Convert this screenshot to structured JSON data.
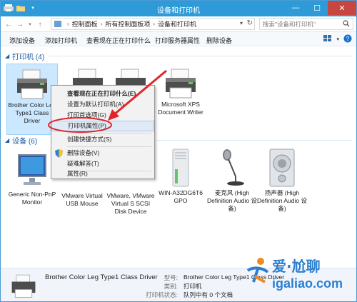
{
  "window": {
    "title": "设备和打印机",
    "controls": [
      "—",
      "☐",
      "✕"
    ]
  },
  "address": {
    "crumbs": [
      "控制面板",
      "所有控制面板项",
      "设备和打印机"
    ],
    "search_placeholder": "搜索\"设备和打印机\""
  },
  "toolbar": {
    "items": [
      "添加设备",
      "添加打印机",
      "查看现在正在打印什么",
      "打印服务器属性",
      "删除设备"
    ]
  },
  "printers": {
    "header": "打印机 (4)",
    "items": [
      {
        "label": "Brother Color Leg Type1 Class Driver",
        "icon": "printer-icon"
      },
      {
        "label": "",
        "icon": "printer-icon"
      },
      {
        "label": "",
        "icon": "printer-icon"
      },
      {
        "label": "Microsoft XPS Document Writer",
        "icon": "printer-icon"
      }
    ]
  },
  "devices": {
    "header": "设备 (6)",
    "items": [
      {
        "label": "Generic Non-PnP Monitor",
        "icon": "monitor-icon"
      },
      {
        "label": "VMware Virtual USB Mouse",
        "icon": "mouse-icon"
      },
      {
        "label": "VMware, VMware Virtual S SCSI Disk Device",
        "icon": "disk-icon"
      },
      {
        "label": "WIN-A32DG6T6 GPO",
        "icon": "computer-tower-icon"
      },
      {
        "label": "麦克风 (High Definition Audio 设备)",
        "icon": "microphone-icon"
      },
      {
        "label": "扬声器 (High Definition Audio 设备)",
        "icon": "speaker-icon"
      }
    ]
  },
  "context_menu": {
    "items": [
      {
        "label": "查看现在正在打印什么(E)",
        "bold": true
      },
      {
        "label": "设置为默认打印机(A)"
      },
      {
        "label": "打印首选项(G)"
      },
      {
        "label": "打印机属性(P)",
        "highlighted": true
      },
      {
        "label": "创建快捷方式(S)"
      },
      {
        "label": "删除设备(V)",
        "shield": true
      },
      {
        "label": "疑难解答(T)"
      },
      {
        "label": "属性(R)"
      }
    ]
  },
  "details": {
    "title": "Brother Color Leg Type1 Class Driver",
    "fields": [
      {
        "key": "型号:",
        "value": "Brother Color Leg Type1 Class Driver"
      },
      {
        "key": "类别:",
        "value": "打印机"
      },
      {
        "key": "打印机状态:",
        "value": "队列中有 0 个文档"
      }
    ]
  },
  "watermark": {
    "line1": "爱·尬聊",
    "line2": "igaliao.com"
  },
  "colors": {
    "titlebar": "#2e9bd8",
    "group_header": "#1a5da8",
    "selection": "#cce8ff",
    "highlight_red": "#e0262b",
    "watermark": "#2a7fd0"
  }
}
